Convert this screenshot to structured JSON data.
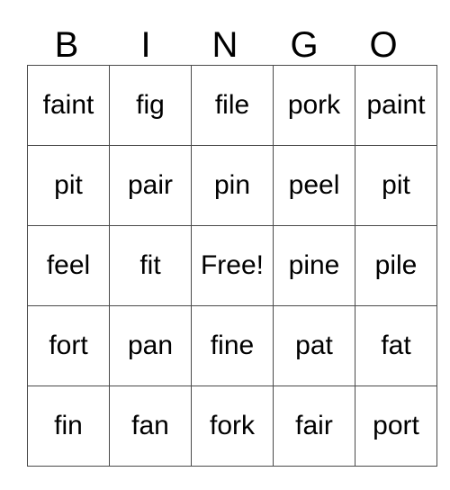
{
  "card": {
    "title": "BINGO",
    "header": {
      "letters": [
        "B",
        "I",
        "N",
        "G",
        "O"
      ]
    },
    "grid": {
      "columns": 5,
      "rows": 5,
      "free_space": {
        "row": 2,
        "col": 2,
        "label": "Free!"
      },
      "cells": [
        [
          "faint",
          "fig",
          "file",
          "pork",
          "paint"
        ],
        [
          "pit",
          "pair",
          "pin",
          "peel",
          "pit"
        ],
        [
          "feel",
          "fit",
          "Free!",
          "pine",
          "pile"
        ],
        [
          "fort",
          "pan",
          "fine",
          "pat",
          "fat"
        ],
        [
          "fin",
          "fan",
          "fork",
          "fair",
          "port"
        ]
      ]
    },
    "colors": {
      "background": "#ffffff",
      "border": "#4a4a4a",
      "text": "#000000"
    }
  }
}
